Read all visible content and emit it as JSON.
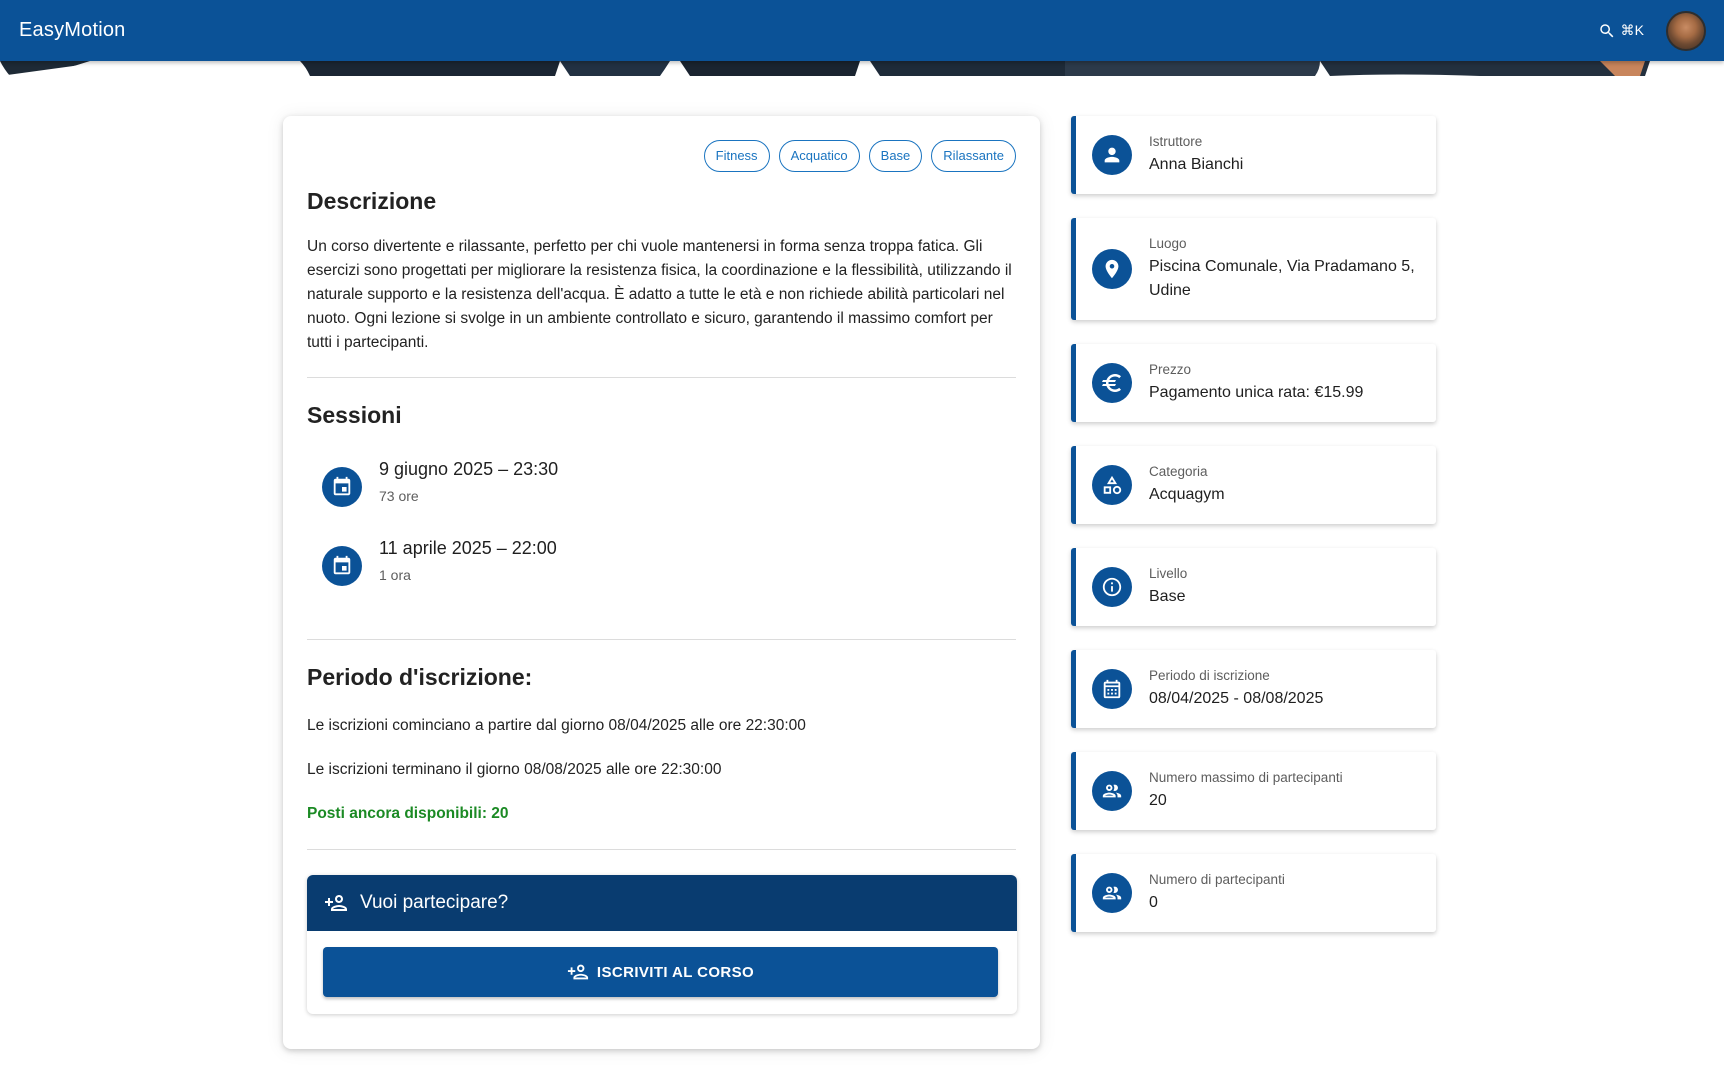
{
  "app": {
    "brand": "EasyMotion",
    "search_shortcut": "⌘K",
    "search_icon": "search-icon",
    "avatar_icon": "user-avatar"
  },
  "course": {
    "tags": [
      "Fitness",
      "Acquatico",
      "Base",
      "Rilassante"
    ],
    "description_title": "Descrizione",
    "description": "Un corso divertente e rilassante, perfetto per chi vuole mantenersi in forma senza troppa fatica. Gli esercizi sono progettati per migliorare la resistenza fisica, la coordinazione e la flessibilità, utilizzando il naturale supporto e la resistenza dell'acqua. È adatto a tutte le età e non richiede abilità particolari nel nuoto. Ogni lezione si svolge in un ambiente controllato e sicuro, garantendo il massimo comfort per tutti i partecipanti.",
    "sessions_title": "Sessioni",
    "sessions": [
      {
        "date": "9 giugno 2025 – 23:30",
        "duration": "73 ore",
        "icon": "calendar-event-icon"
      },
      {
        "date": "11 aprile 2025 – 22:00",
        "duration": "1 ora",
        "icon": "calendar-event-icon"
      }
    ],
    "period_title": "Periodo d'iscrizione:",
    "period_start_text": "Le iscrizioni cominciano a partire dal giorno 08/04/2025 alle ore 22:30:00",
    "period_end_text": "Le iscrizioni terminano il giorno 08/08/2025 alle ore 22:30:00",
    "available_text": "Posti ancora disponibili: 20",
    "join_title": "Vuoi partecipare?",
    "join_button": "ISCRIVITI AL CORSO",
    "accent_color": "#0b5297",
    "header_color": "#093c70",
    "available_color": "#1b8a24"
  },
  "info": [
    {
      "label": "Istruttore",
      "value": "Anna Bianchi",
      "icon": "person-icon"
    },
    {
      "label": "Luogo",
      "value": "Piscina Comunale, Via Pradamano 5, Udine",
      "icon": "location-pin-icon"
    },
    {
      "label": "Prezzo",
      "value": "Pagamento unica rata: €15.99",
      "icon": "euro-icon"
    },
    {
      "label": "Categoria",
      "value": "Acquagym",
      "icon": "category-icon"
    },
    {
      "label": "Livello",
      "value": "Base",
      "icon": "info-icon"
    },
    {
      "label": "Periodo di iscrizione",
      "value": "08/04/2025 - 08/08/2025",
      "icon": "calendar-month-icon"
    },
    {
      "label": "Numero massimo di partecipanti",
      "value": "20",
      "icon": "group-icon"
    },
    {
      "label": "Numero di partecipanti",
      "value": "0",
      "icon": "group-icon"
    }
  ]
}
